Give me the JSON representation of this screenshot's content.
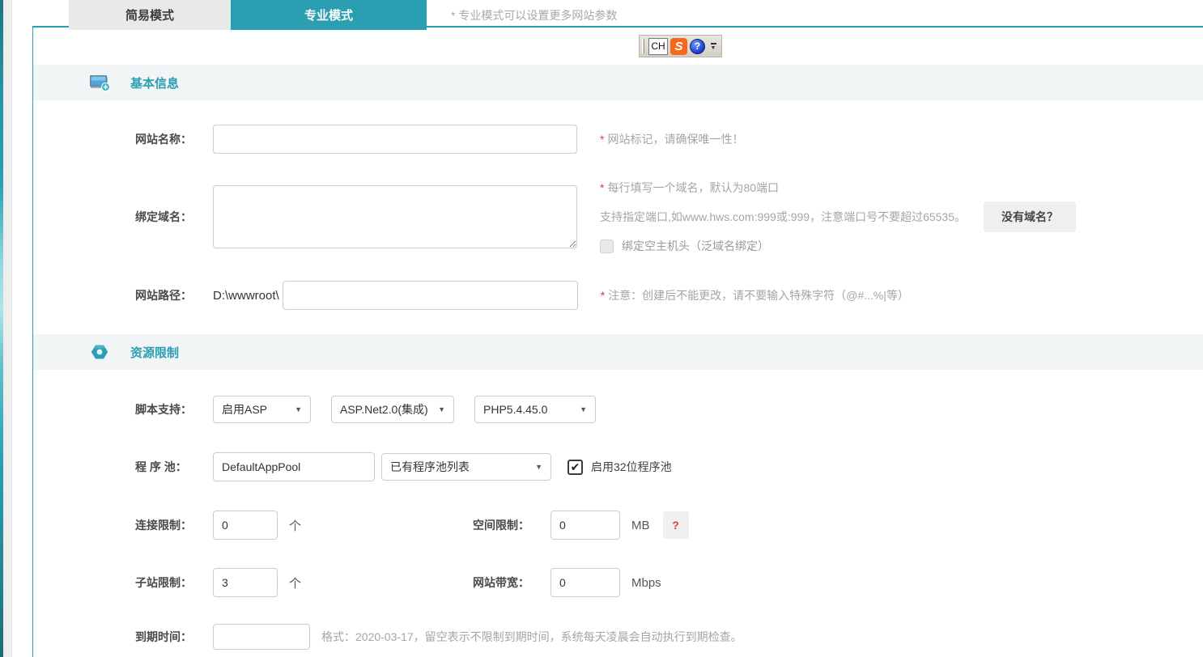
{
  "tabs": {
    "simple": "简易模式",
    "pro": "专业模式",
    "note": "* 专业模式可以设置更多网站参数"
  },
  "langbar": {
    "ch": "CH",
    "sogou": "S",
    "help": "?"
  },
  "sections": {
    "basic": {
      "title": "基本信息"
    },
    "resource": {
      "title": "资源限制"
    }
  },
  "fields": {
    "site_name": {
      "label": "网站名称：",
      "value": "",
      "star": "*",
      "note": "网站标记，请确保唯一性！"
    },
    "bind_domain": {
      "label": "绑定域名：",
      "value": "",
      "star": "*",
      "note1": "每行填写一个域名，默认为80端口",
      "note2": "支持指定端口,如www.hws.com:999或:999，注意端口号不要超过65535。",
      "no_domain_button": "没有域名？",
      "wildcard_label": "绑定空主机头（泛域名绑定）"
    },
    "site_path": {
      "label": "网站路径：",
      "prefix": "D:\\wwwroot\\",
      "value": "",
      "star": "*",
      "note": "注意：创建后不能更改，请不要输入特殊字符（@#...%|等）"
    },
    "script_support": {
      "label": "脚本支持：",
      "asp": "启用ASP",
      "aspnet": "ASP.Net2.0(集成)",
      "php": "PHP5.4.45.0"
    },
    "app_pool": {
      "label": "程 序 池：",
      "value": "DefaultAppPool",
      "list_label": "已有程序池列表",
      "enable32_label": "启用32位程序池"
    },
    "conn_limit": {
      "label": "连接限制：",
      "value": "0",
      "unit": "个"
    },
    "space_limit": {
      "label": "空间限制：",
      "value": "0",
      "unit": "MB",
      "help": "?"
    },
    "sub_site_limit": {
      "label": "子站限制：",
      "value": "3",
      "unit": "个"
    },
    "bandwidth": {
      "label": "网站带宽：",
      "value": "0",
      "unit": "Mbps"
    },
    "expiry": {
      "label": "到期时间：",
      "value": "",
      "note": "格式：2020-03-17，留空表示不限制到期时间，系统每天凌晨会自动执行到期检查。"
    }
  },
  "colors": {
    "accent": "#2a9fb2",
    "error_red": "#e6393d",
    "sogou_orange": "#f4691e",
    "help_blue": "#1d39c8"
  }
}
